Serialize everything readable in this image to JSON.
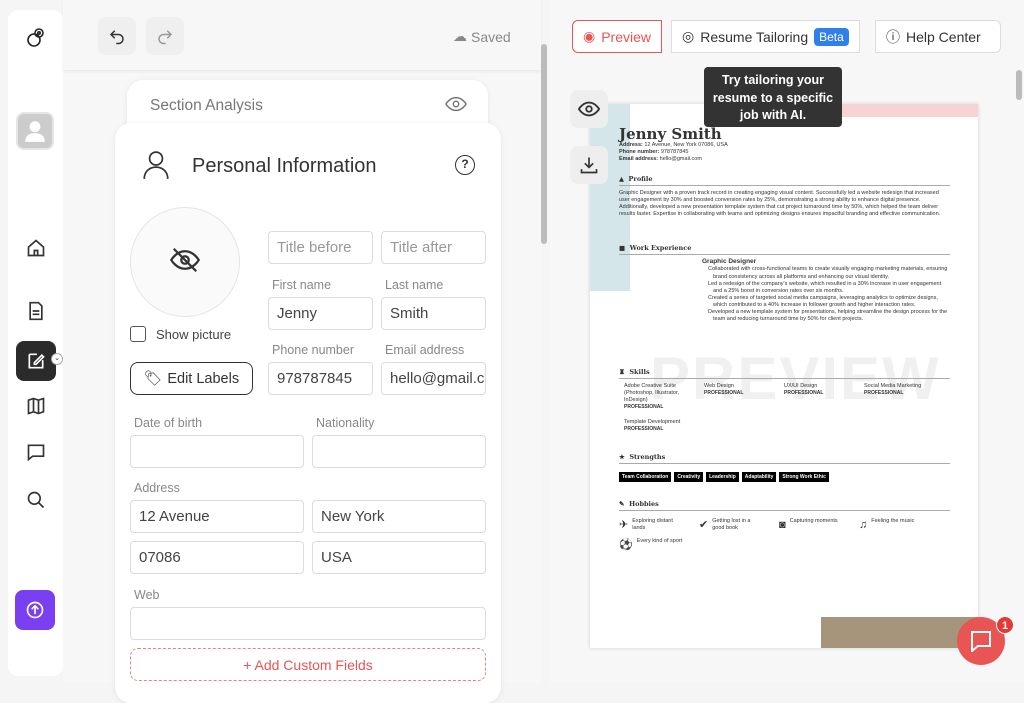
{
  "toolbar": {
    "saved": "Saved"
  },
  "section_analysis": {
    "title": "Section Analysis"
  },
  "personal": {
    "title": "Personal Information",
    "show_picture": "Show picture",
    "edit_labels": "Edit Labels",
    "title_before_ph": "Title before",
    "title_after_ph": "Title after",
    "first_name_label": "First name",
    "first_name": "Jenny",
    "last_name_label": "Last name",
    "last_name": "Smith",
    "phone_label": "Phone number",
    "phone": "978787845",
    "email_label": "Email address",
    "email": "hello@gmail.com",
    "dob_label": "Date of birth",
    "nationality_label": "Nationality",
    "address_label": "Address",
    "street": "12 Avenue",
    "city": "New York",
    "zip": "07086",
    "country": "USA",
    "web_label": "Web",
    "add_custom": "+ Add Custom Fields"
  },
  "tabs": {
    "preview": "Preview",
    "tailoring": "Resume Tailoring",
    "beta": "Beta",
    "help": "Help Center"
  },
  "tooltip": "Try tailoring your resume to a specific job with AI.",
  "chat_badge": "1",
  "resume": {
    "name": "Jenny Smith",
    "address_label": "Address:",
    "address": "12 Avenue, New York 07086, USA",
    "phone_label": "Phone number:",
    "phone": "978787845",
    "email_label": "Email address:",
    "email": "hello@gmail.com",
    "profile_h": "Profile",
    "profile": "Graphic Designer with a proven track record in creating engaging visual content. Successfully led a website redesign that increased user engagement by 30% and boosted conversion rates by 25%, demonstrating a strong ability to enhance digital presence. Additionally, developed a new presentation template system that cut project turnaround time by 50%, which helped the team deliver results faster. Expertise in collaborating with teams and optimizing designs ensures impactful branding and effective communication.",
    "work_h": "Work Experience",
    "job": "Graphic Designer",
    "bullets": [
      "Collaborated with cross-functional teams to create visually engaging marketing materials, ensuring brand consistency across all platforms and enhancing our visual identity.",
      "Led a redesign of the company's website, which resulted in a 30% increase in user engagement and a 25% boost in conversion rates over six months.",
      "Created a series of targeted social media campaigns, leveraging analytics to optimize designs, which contributed to a 40% increase in follower growth and higher interaction rates.",
      "Developed a new template system for presentations, helping streamline the design process for the team and reducing turnaround time by 50% for client projects."
    ],
    "watermark": "PREVIEW",
    "skills_h": "Skills",
    "skills": [
      {
        "n": "Adobe Creative Suite (Photoshop, Illustrator, InDesign)",
        "l": "PROFESSIONAL"
      },
      {
        "n": "Web Design",
        "l": "PROFESSIONAL"
      },
      {
        "n": "UX/UI Design",
        "l": "PROFESSIONAL"
      },
      {
        "n": "Social Media Marketing",
        "l": "PROFESSIONAL"
      },
      {
        "n": "Template Development",
        "l": "PROFESSIONAL"
      }
    ],
    "strengths_h": "Strengths",
    "strengths": [
      "Team Collaboration",
      "Creativity",
      "Leadership",
      "Adaptability",
      "Strong Work Ethic"
    ],
    "hobbies_h": "Hobbies",
    "hobbies": [
      "Exploring distant lands",
      "Getting lost in a good book",
      "Capturing moments",
      "Feeling the music",
      "Every kind of sport"
    ]
  }
}
